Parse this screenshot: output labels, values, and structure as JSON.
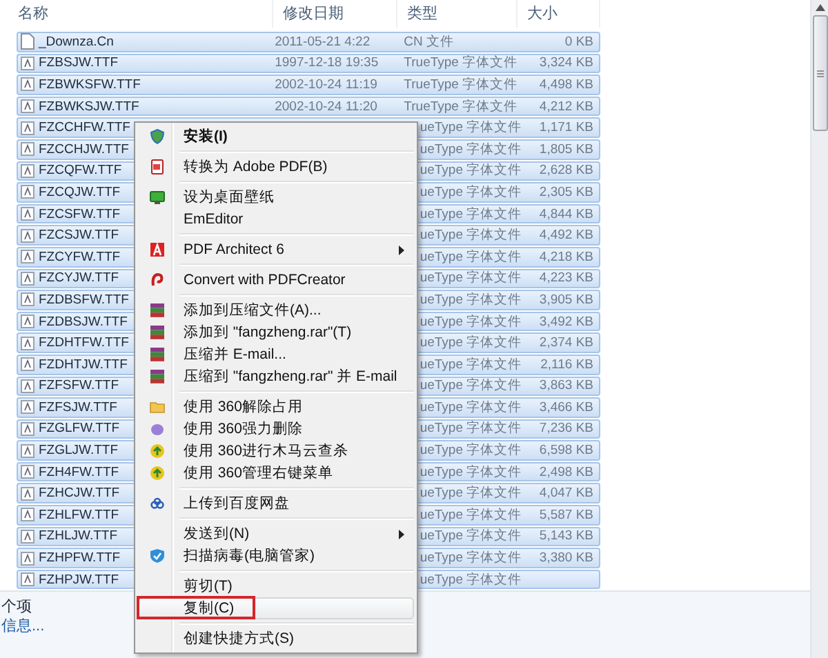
{
  "header": {
    "columns": [
      "名称",
      "修改日期",
      "类型",
      "大小"
    ]
  },
  "rows": [
    {
      "name": "_Downza.Cn",
      "date": "2011-05-21 4:22",
      "type": "CN 文件",
      "size": "0 KB",
      "kind": "file",
      "selected": true
    },
    {
      "name": "FZBSJW.TTF",
      "date": "1997-12-18 19:35",
      "type": "TrueType 字体文件",
      "size": "3,324 KB",
      "kind": "font",
      "selected": true
    },
    {
      "name": "FZBWKSFW.TTF",
      "date": "2002-10-24 11:19",
      "type": "TrueType 字体文件",
      "size": "4,498 KB",
      "kind": "font",
      "selected": true
    },
    {
      "name": "FZBWKSJW.TTF",
      "date": "2002-10-24 11:20",
      "type": "TrueType 字体文件",
      "size": "4,212 KB",
      "kind": "font",
      "selected": true
    },
    {
      "name": "FZCCHFW.TTF",
      "type": "ueType 字体文件",
      "size": "1,171 KB",
      "kind": "font",
      "selected": true
    },
    {
      "name": "FZCCHJW.TTF",
      "type": "ueType 字体文件",
      "size": "1,805 KB",
      "kind": "font",
      "selected": true
    },
    {
      "name": "FZCQFW.TTF",
      "type": "ueType 字体文件",
      "size": "2,628 KB",
      "kind": "font",
      "selected": true
    },
    {
      "name": "FZCQJW.TTF",
      "type": "ueType 字体文件",
      "size": "2,305 KB",
      "kind": "font",
      "selected": true
    },
    {
      "name": "FZCSFW.TTF",
      "type": "ueType 字体文件",
      "size": "4,844 KB",
      "kind": "font",
      "selected": true
    },
    {
      "name": "FZCSJW.TTF",
      "type": "ueType 字体文件",
      "size": "4,492 KB",
      "kind": "font",
      "selected": true
    },
    {
      "name": "FZCYFW.TTF",
      "type": "ueType 字体文件",
      "size": "4,218 KB",
      "kind": "font",
      "selected": true
    },
    {
      "name": "FZCYJW.TTF",
      "type": "ueType 字体文件",
      "size": "4,223 KB",
      "kind": "font",
      "selected": true
    },
    {
      "name": "FZDBSFW.TTF",
      "type": "ueType 字体文件",
      "size": "3,905 KB",
      "kind": "font",
      "selected": true
    },
    {
      "name": "FZDBSJW.TTF",
      "type": "ueType 字体文件",
      "size": "3,492 KB",
      "kind": "font",
      "selected": true
    },
    {
      "name": "FZDHTFW.TTF",
      "type": "ueType 字体文件",
      "size": "2,374 KB",
      "kind": "font",
      "selected": true
    },
    {
      "name": "FZDHTJW.TTF",
      "type": "ueType 字体文件",
      "size": "2,116 KB",
      "kind": "font",
      "selected": true
    },
    {
      "name": "FZFSFW.TTF",
      "type": "ueType 字体文件",
      "size": "3,863 KB",
      "kind": "font",
      "selected": true
    },
    {
      "name": "FZFSJW.TTF",
      "type": "ueType 字体文件",
      "size": "3,466 KB",
      "kind": "font",
      "selected": true
    },
    {
      "name": "FZGLFW.TTF",
      "type": "ueType 字体文件",
      "size": "7,236 KB",
      "kind": "font",
      "selected": true
    },
    {
      "name": "FZGLJW.TTF",
      "type": "ueType 字体文件",
      "size": "6,598 KB",
      "kind": "font",
      "selected": true
    },
    {
      "name": "FZH4FW.TTF",
      "type": "ueType 字体文件",
      "size": "2,498 KB",
      "kind": "font",
      "selected": true
    },
    {
      "name": "FZHCJW.TTF",
      "type": "ueType 字体文件",
      "size": "4,047 KB",
      "kind": "font",
      "selected": true
    },
    {
      "name": "FZHLFW.TTF",
      "type": "ueType 字体文件",
      "size": "5,587 KB",
      "kind": "font",
      "selected": true
    },
    {
      "name": "FZHLJW.TTF",
      "type": "ueType 字体文件",
      "size": "5,143 KB",
      "kind": "font",
      "selected": true
    },
    {
      "name": "FZHPFW.TTF",
      "type": "ueType 字体文件",
      "size": "3,380 KB",
      "kind": "font",
      "selected": true
    },
    {
      "name": "FZHPJW.TTF",
      "type": "ueType 字体文件",
      "kind": "font",
      "selected": true
    }
  ],
  "details": {
    "count": "个项",
    "link": "信息..."
  },
  "context_menu": {
    "items": [
      {
        "kind": "item",
        "label": "安装(I)",
        "default": true,
        "submenu": false,
        "selected": false
      },
      {
        "kind": "separator"
      },
      {
        "kind": "item",
        "label": "转换为 Adobe PDF(B)",
        "default": false,
        "submenu": false,
        "selected": false
      },
      {
        "kind": "separator"
      },
      {
        "kind": "item",
        "label": "设为桌面壁纸",
        "default": false,
        "submenu": false,
        "selected": false
      },
      {
        "kind": "item",
        "label": "EmEditor",
        "default": false,
        "submenu": false,
        "selected": false
      },
      {
        "kind": "separator"
      },
      {
        "kind": "item",
        "label": "PDF Architect 6",
        "default": false,
        "submenu": true,
        "selected": false
      },
      {
        "kind": "separator"
      },
      {
        "kind": "item",
        "label": "Convert with PDFCreator",
        "default": false,
        "submenu": false,
        "selected": false
      },
      {
        "kind": "separator"
      },
      {
        "kind": "item",
        "label": "添加到压缩文件(A)...",
        "default": false,
        "submenu": false,
        "selected": false
      },
      {
        "kind": "item",
        "label": "添加到 \"fangzheng.rar\"(T)",
        "default": false,
        "submenu": false,
        "selected": false
      },
      {
        "kind": "item",
        "label": "压缩并 E-mail...",
        "default": false,
        "submenu": false,
        "selected": false
      },
      {
        "kind": "item",
        "label": "压缩到 \"fangzheng.rar\" 并 E-mail",
        "default": false,
        "submenu": false,
        "selected": false
      },
      {
        "kind": "separator"
      },
      {
        "kind": "item",
        "label": "使用 360解除占用",
        "default": false,
        "submenu": false,
        "selected": false
      },
      {
        "kind": "item",
        "label": "使用 360强力删除",
        "default": false,
        "submenu": false,
        "selected": false
      },
      {
        "kind": "item",
        "label": "使用 360进行木马云查杀",
        "default": false,
        "submenu": false,
        "selected": false
      },
      {
        "kind": "item",
        "label": "使用 360管理右键菜单",
        "default": false,
        "submenu": false,
        "selected": false
      },
      {
        "kind": "separator"
      },
      {
        "kind": "item",
        "label": "上传到百度网盘",
        "default": false,
        "submenu": false,
        "selected": false
      },
      {
        "kind": "separator"
      },
      {
        "kind": "item",
        "label": "发送到(N)",
        "default": false,
        "submenu": true,
        "selected": false
      },
      {
        "kind": "item",
        "label": "扫描病毒(电脑管家)",
        "default": false,
        "submenu": false,
        "selected": false
      },
      {
        "kind": "separator"
      },
      {
        "kind": "item",
        "label": "剪切(T)",
        "default": false,
        "submenu": false,
        "selected": false
      },
      {
        "kind": "item",
        "label": "复制(C)",
        "default": false,
        "submenu": false,
        "selected": true
      },
      {
        "kind": "separator"
      },
      {
        "kind": "item",
        "label": "创建快捷方式(S)",
        "default": false,
        "submenu": false,
        "selected": false
      }
    ]
  }
}
